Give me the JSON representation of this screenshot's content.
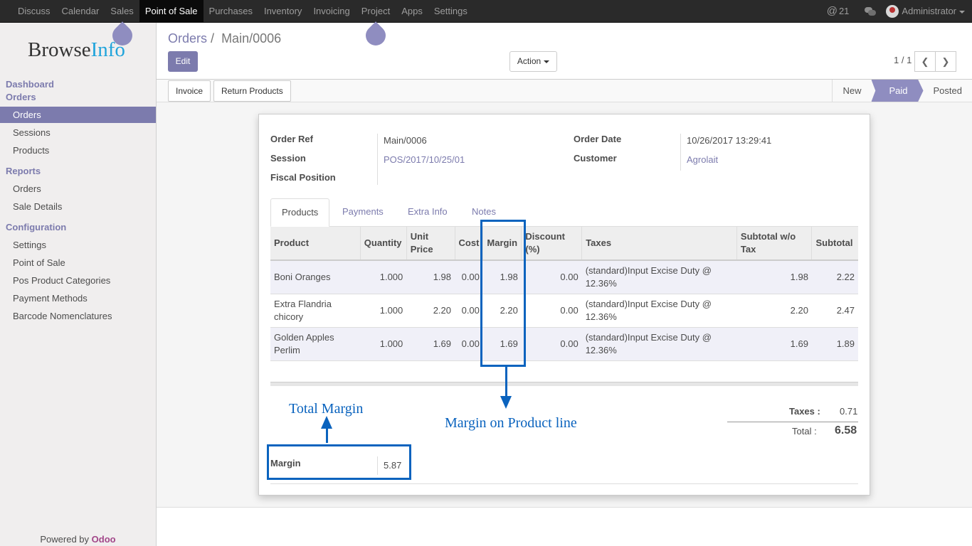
{
  "topbar": {
    "menu": [
      "Discuss",
      "Calendar",
      "Sales",
      "Point of Sale",
      "Purchases",
      "Inventory",
      "Invoicing",
      "Project",
      "Apps",
      "Settings"
    ],
    "active": "Point of Sale",
    "mentions_count": "21",
    "user": "Administrator"
  },
  "sidebar": {
    "logo_part1": "Browse",
    "logo_part2": "Info",
    "sections": {
      "dashboard": "Dashboard",
      "orders": "Orders",
      "reports": "Reports",
      "configuration": "Configuration"
    },
    "orders_items": [
      "Orders",
      "Sessions",
      "Products"
    ],
    "reports_items": [
      "Orders",
      "Sale Details"
    ],
    "config_items": [
      "Settings",
      "Point of Sale",
      "Pos Product Categories",
      "Payment Methods",
      "Barcode Nomenclatures"
    ],
    "powered_by": "Powered by",
    "powered_brand": "Odoo"
  },
  "control_panel": {
    "breadcrumb_parent": "Orders",
    "breadcrumb_sep": "/",
    "breadcrumb_current": "Main/0006",
    "edit_label": "Edit",
    "action_label": "Action",
    "pager": "1 / 1"
  },
  "statusbar": {
    "invoice_label": "Invoice",
    "return_label": "Return Products",
    "stages": [
      "New",
      "Paid",
      "Posted"
    ],
    "active_stage": "Paid"
  },
  "form": {
    "order_ref_label": "Order Ref",
    "order_ref": "Main/0006",
    "session_label": "Session",
    "session": "POS/2017/10/25/01",
    "fiscal_position_label": "Fiscal Position",
    "order_date_label": "Order Date",
    "order_date": "10/26/2017 13:29:41",
    "customer_label": "Customer",
    "customer": "Agrolait"
  },
  "tabs": [
    "Products",
    "Payments",
    "Extra Info",
    "Notes"
  ],
  "table": {
    "headers": [
      "Product",
      "Quantity",
      "Unit Price",
      "Cost",
      "Margin",
      "Discount (%)",
      "Taxes",
      "Subtotal w/o Tax",
      "Subtotal"
    ],
    "rows": [
      [
        "Boni Oranges",
        "1.000",
        "1.98",
        "0.00",
        "1.98",
        "0.00",
        "(standard)Input Excise Duty @ 12.36%",
        "1.98",
        "2.22"
      ],
      [
        "Extra Flandria chicory",
        "1.000",
        "2.20",
        "0.00",
        "2.20",
        "0.00",
        "(standard)Input Excise Duty @ 12.36%",
        "2.20",
        "2.47"
      ],
      [
        "Golden Apples Perlim",
        "1.000",
        "1.69",
        "0.00",
        "1.69",
        "0.00",
        "(standard)Input Excise Duty @ 12.36%",
        "1.69",
        "1.89"
      ]
    ]
  },
  "totals": {
    "taxes_label": "Taxes :",
    "taxes": "0.71",
    "total_label": "Total :",
    "total": "6.58"
  },
  "margin": {
    "label": "Margin",
    "value": "5.87"
  },
  "annotations": {
    "total_margin": "Total Margin",
    "line_margin": "Margin on Product line"
  },
  "colors": {
    "accent": "#7c7bad",
    "annotation": "#0a63be",
    "topbar": "#2a2a2a"
  }
}
